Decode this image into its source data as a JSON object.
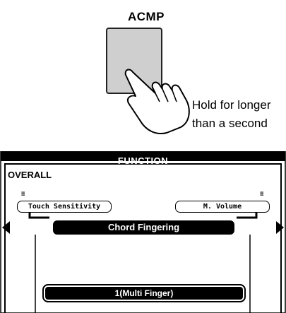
{
  "acmp": {
    "label": "ACMP"
  },
  "hint": {
    "line1": "Hold for longer",
    "line2": "than a second"
  },
  "lcd": {
    "title": "FUNCTION",
    "category": "OVERALL",
    "left_item": "Touch Sensitivity",
    "right_item": "M. Volume",
    "selected_item": "Chord Fingering",
    "value": "1(Multi Finger)"
  },
  "colors": {
    "button_fill": "#cfcfcf",
    "lcd_black": "#000000"
  },
  "icons": {
    "hand": "pressing-hand-icon",
    "left": "triangle-left-icon",
    "right": "triangle-right-icon"
  }
}
